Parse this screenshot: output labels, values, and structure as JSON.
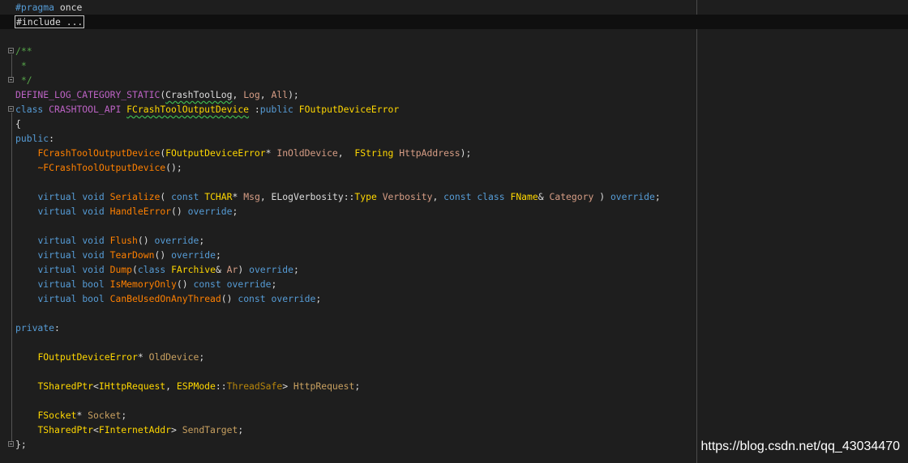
{
  "editor": {
    "watermark": "https://blog.csdn.net/qq_43034470"
  },
  "code": {
    "l1": {
      "a": "#pragma",
      "b": " once"
    },
    "l2": {
      "a": "#include ..."
    },
    "l4": {
      "a": "/**"
    },
    "l5": {
      "a": " *"
    },
    "l6": {
      "a": " */"
    },
    "l7": {
      "a": "DEFINE_LOG_CATEGORY_STATIC",
      "b": "(",
      "c": "CrashToolLog",
      "d": ", ",
      "e": "Log",
      "f": ", ",
      "g": "All",
      "h": ");"
    },
    "l8": {
      "a": "class",
      "b": " ",
      "c": "CRASHTOOL_API",
      "d": " ",
      "e": "FCrashToolOutputDevice",
      "f": " :",
      "g": "public",
      "h": " ",
      "i": "FOutputDeviceError"
    },
    "l9": {
      "a": "{"
    },
    "l10": {
      "a": "public",
      "b": ":"
    },
    "l11": {
      "a": "    ",
      "b": "FCrashToolOutputDevice",
      "c": "(",
      "d": "FOutputDeviceError",
      "e": "* ",
      "f": "InOldDevice",
      "g": ",  ",
      "h": "FString",
      "i": " ",
      "j": "HttpAddress",
      "k": ");"
    },
    "l12": {
      "a": "    ",
      "b": "~FCrashToolOutputDevice",
      "c": "();"
    },
    "l14": {
      "a": "    ",
      "b": "virtual",
      "c": " ",
      "d": "void",
      "e": " ",
      "f": "Serialize",
      "g": "( ",
      "h": "const",
      "i": " ",
      "j": "TCHAR",
      "k": "* ",
      "l": "Msg",
      "m": ", ",
      "n": "ELogVerbosity",
      "o": "::",
      "p": "Type",
      "q": " ",
      "r": "Verbosity",
      "s": ", ",
      "t": "const",
      "u": " ",
      "v": "class",
      "w": " ",
      "x": "FName",
      "y": "& ",
      "z": "Category",
      "z1": " ) ",
      "z2": "override",
      "z3": ";"
    },
    "l15": {
      "a": "    ",
      "b": "virtual",
      "c": " ",
      "d": "void",
      "e": " ",
      "f": "HandleError",
      "g": "() ",
      "h": "override",
      "i": ";"
    },
    "l17": {
      "a": "    ",
      "b": "virtual",
      "c": " ",
      "d": "void",
      "e": " ",
      "f": "Flush",
      "g": "() ",
      "h": "override",
      "i": ";"
    },
    "l18": {
      "a": "    ",
      "b": "virtual",
      "c": " ",
      "d": "void",
      "e": " ",
      "f": "TearDown",
      "g": "() ",
      "h": "override",
      "i": ";"
    },
    "l19": {
      "a": "    ",
      "b": "virtual",
      "c": " ",
      "d": "void",
      "e": " ",
      "f": "Dump",
      "g": "(",
      "h": "class",
      "i": " ",
      "j": "FArchive",
      "k": "& ",
      "l": "Ar",
      "m": ") ",
      "n": "override",
      "o": ";"
    },
    "l20": {
      "a": "    ",
      "b": "virtual",
      "c": " ",
      "d": "bool",
      "e": " ",
      "f": "IsMemoryOnly",
      "g": "() ",
      "h": "const",
      "i": " ",
      "j": "override",
      "k": ";"
    },
    "l21": {
      "a": "    ",
      "b": "virtual",
      "c": " ",
      "d": "bool",
      "e": " ",
      "f": "CanBeUsedOnAnyThread",
      "g": "() ",
      "h": "const",
      "i": " ",
      "j": "override",
      "k": ";"
    },
    "l23": {
      "a": "private",
      "b": ":"
    },
    "l25": {
      "a": "    ",
      "b": "FOutputDeviceError",
      "c": "* ",
      "d": "OldDevice",
      "e": ";"
    },
    "l27": {
      "a": "    ",
      "b": "TSharedPtr",
      "c": "<",
      "d": "IHttpRequest",
      "e": ", ",
      "f": "ESPMode",
      "g": "::",
      "h": "ThreadSafe",
      "i": "> ",
      "j": "HttpRequest",
      "k": ";"
    },
    "l29": {
      "a": "    ",
      "b": "FSocket",
      "c": "* ",
      "d": "Socket",
      "e": ";"
    },
    "l30": {
      "a": "    ",
      "b": "TSharedPtr",
      "c": "<",
      "d": "FInternetAddr",
      "e": "> ",
      "f": "SendTarget",
      "g": ";"
    },
    "l31": {
      "a": "};"
    }
  }
}
